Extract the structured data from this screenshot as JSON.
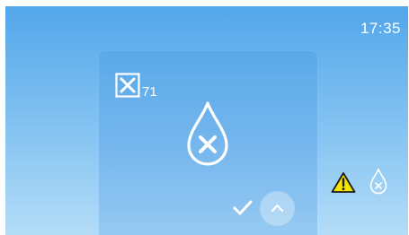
{
  "status_bar": {
    "time": "17:35"
  },
  "error_panel": {
    "error_count": "71",
    "icons": {
      "error_box": "close-box-icon",
      "main": "water-drop-error-icon",
      "confirm": "checkmark-icon",
      "expand": "chevron-up-icon"
    }
  },
  "status_icons": {
    "warning": "warning-triangle-icon",
    "water": "water-drop-error-icon"
  },
  "colors": {
    "background_top": "#52a6ea",
    "background_bottom": "#b3dcf7",
    "warning_fill": "#f5e400",
    "foreground": "#ffffff"
  }
}
